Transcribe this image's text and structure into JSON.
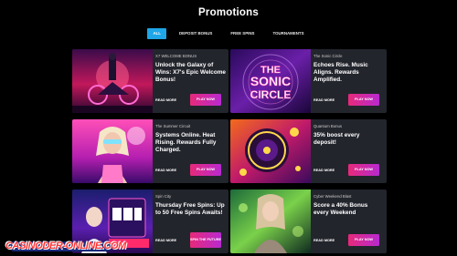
{
  "page": {
    "title": "Promotions"
  },
  "tabs": [
    {
      "label": "ALL",
      "active": true
    },
    {
      "label": "DEPOSIT BONUS",
      "active": false
    },
    {
      "label": "FREE SPINS",
      "active": false
    },
    {
      "label": "TOURNAMENTS",
      "active": false
    }
  ],
  "cards": [
    {
      "subtitle": "X7 WELCOME BONUS",
      "headline": "Unlock the Galaxy of Wins: X7's Epic Welcome Bonus!",
      "read_more": "READ MORE",
      "cta": "PLAY NOW"
    },
    {
      "subtitle": "The Sonic Circle",
      "headline": "Echoes Rise. Music Aligns. Rewards Amplified.",
      "read_more": "READ MORE",
      "cta": "PLAY NOW",
      "art_text_top": "THE",
      "art_text_mid": "SONIC",
      "art_text_bottom": "CIRCLE"
    },
    {
      "subtitle": "The Summer Circuit",
      "headline": "Systems Online. Heat Rising. Rewards Fully Charged.",
      "read_more": "READ MORE",
      "cta": "PLAY NOW"
    },
    {
      "subtitle": "Quantum Bonus",
      "headline": "35% boost every deposit!",
      "read_more": "READ MORE",
      "cta": "PLAY NOW"
    },
    {
      "subtitle": "Spin City",
      "headline": "Thursday Free Spins: Up to 50 Free Spins Awaits!",
      "read_more": "READ MORE",
      "cta": "SPIN THE FUTURE"
    },
    {
      "subtitle": "Cyber Weekend Blast",
      "headline": "Score a 40% Bonus every Weekend",
      "read_more": "READ MORE",
      "cta": "PLAY NOW"
    }
  ],
  "watermark": {
    "text": "CASINODER-ONLINE.COM"
  },
  "colors": {
    "accent_tab": "#1ea6e8",
    "cta_start": "#e62a7a",
    "cta_end": "#b82ad0",
    "card_bg": "#23252d"
  }
}
